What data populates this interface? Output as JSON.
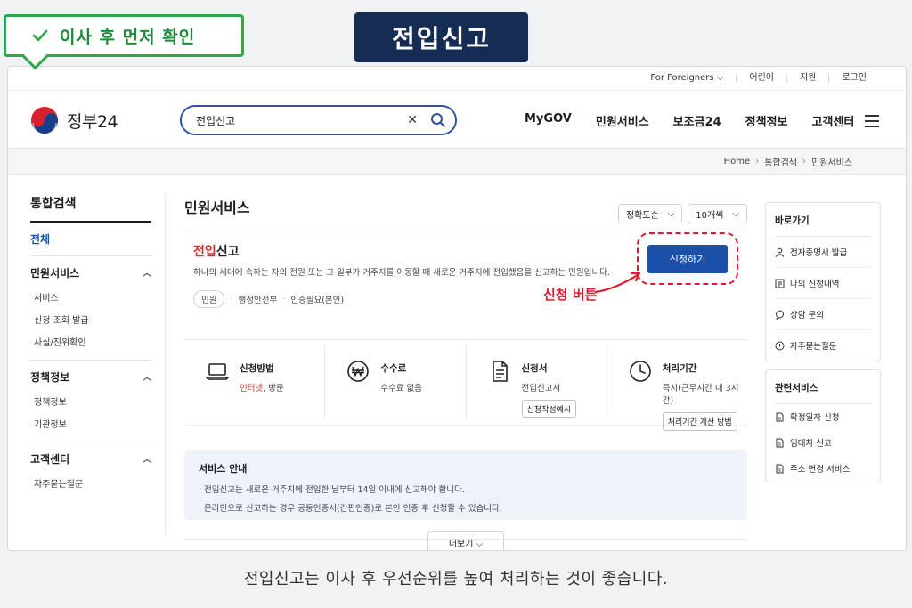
{
  "callout": {
    "text": "이사 후 먼저 확인",
    "color": "#2ea84a"
  },
  "title_pill": {
    "text": "전입신고",
    "color": "#152c55"
  },
  "util_links": [
    "For Foreigners ⌵",
    "어린이",
    "지원",
    "로그인"
  ],
  "brand": {
    "name": "정부24"
  },
  "search": {
    "value": "전입신고",
    "clear_icon": "close-icon",
    "search_icon": "search-icon"
  },
  "gnb": [
    "MyGOV",
    "민원서비스",
    "보조금24",
    "정책정보",
    "고객센터"
  ],
  "breadcrumb": [
    "Home",
    "통합검색",
    "민원서비스"
  ],
  "left_nav": {
    "title": "통합검색",
    "all": "전체",
    "groups": [
      {
        "title": "민원서비스",
        "items": [
          "서비스",
          "신청·조회·발급",
          "사실/진위확인"
        ]
      },
      {
        "title": "정책정보",
        "items": [
          "정책정보",
          "기관정보"
        ]
      },
      {
        "title": "고객센터",
        "items": [
          "자주묻는질문"
        ]
      }
    ]
  },
  "main": {
    "heading": "민원서비스",
    "sort": {
      "order": "정확도순",
      "count": "10개씩"
    },
    "service": {
      "title_highlight": "전입",
      "title_rest": "신고",
      "desc": "하나의 세대에 속하는 자의 전원 또는 그 일부가 거주지를 이동할 때 새로운 거주지에 전입했음을 신고하는 민원입니다.",
      "tags": [
        "민원",
        "행정안전부",
        "인증필요(본인)"
      ],
      "apply_label": "신청하기",
      "apply_note": "신청 버튼",
      "accent": "#e0182d"
    },
    "info": [
      {
        "label": "신청방법",
        "value_red": "인터넷",
        "value_rest": ", 방문",
        "icon": "laptop-icon"
      },
      {
        "label": "수수료",
        "value": "수수료 없음",
        "icon": "won-icon"
      },
      {
        "label": "신청서",
        "value": "전입신고서",
        "button": "신청작성예시",
        "icon": "document-icon"
      },
      {
        "label": "처리기간",
        "value": "즉시(근무시간 내 3시간)",
        "button": "처리기간 계산 방법",
        "icon": "clock-icon"
      }
    ],
    "guide": {
      "title": "서비스 안내",
      "lines": [
        "· 전입신고는 새로운 거주지에 전입한 날부터 14일 이내에 신고해야 합니다.",
        "· 온라인으로 신고하는 경우 공동인증서(간편인증)로 본인 인증 후 신청할 수 있습니다."
      ]
    },
    "more_label": "더보기 ⌵"
  },
  "shortcuts": {
    "title": "바로가기",
    "items": [
      "전자증명서 발급",
      "나의 신청내역",
      "상담 문의",
      "자주묻는질문"
    ]
  },
  "related": {
    "title": "관련서비스",
    "items": [
      "확정일자 신청",
      "임대차 신고",
      "주소 변경 서비스"
    ]
  },
  "caption": "전입신고는 이사 후 우선순위를 높여 처리하는 것이 좋습니다."
}
